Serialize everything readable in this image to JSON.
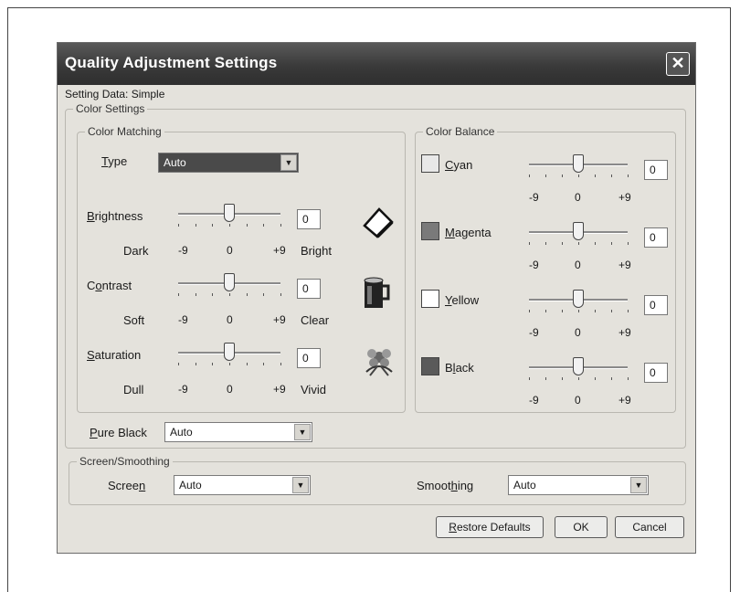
{
  "dialog": {
    "title": "Quality Adjustment Settings",
    "close_label": "✕",
    "setting_data": "Setting Data: Simple"
  },
  "color_settings": {
    "legend": "Color Settings",
    "color_matching": {
      "legend": "Color Matching",
      "type_label": "Type",
      "type_value": "Auto",
      "sliders": [
        {
          "label": "Brightness",
          "value": "0",
          "low_label": "Dark",
          "high_label": "Bright",
          "min": "-9",
          "mid": "0",
          "max": "+9",
          "level": 0,
          "icon": "page-icon"
        },
        {
          "label": "Contrast",
          "value": "0",
          "low_label": "Soft",
          "high_label": "Clear",
          "min": "-9",
          "mid": "0",
          "max": "+9",
          "level": 0,
          "icon": "mug-icon"
        },
        {
          "label": "Saturation",
          "value": "0",
          "low_label": "Dull",
          "high_label": "Vivid",
          "min": "-9",
          "mid": "0",
          "max": "+9",
          "level": 0,
          "icon": "flower-icon"
        }
      ]
    },
    "color_balance": {
      "legend": "Color Balance",
      "channels": [
        {
          "label": "Cyan",
          "value": "0",
          "min": "-9",
          "mid": "0",
          "max": "+9",
          "swatch": "#e8e8e8"
        },
        {
          "label": "Magenta",
          "value": "0",
          "min": "-9",
          "mid": "0",
          "max": "+9",
          "swatch": "#7a7a7a"
        },
        {
          "label": "Yellow",
          "value": "0",
          "min": "-9",
          "mid": "0",
          "max": "+9",
          "swatch": "#ffffff"
        },
        {
          "label": "Black",
          "value": "0",
          "min": "-9",
          "mid": "0",
          "max": "+9",
          "swatch": "#5a5a5a"
        }
      ]
    },
    "pure_black_label": "Pure Black",
    "pure_black_value": "Auto"
  },
  "screen_smoothing": {
    "legend": "Screen/Smoothing",
    "screen_label": "Screen",
    "screen_value": "Auto",
    "smoothing_label": "Smoothing",
    "smoothing_value": "Auto"
  },
  "buttons": {
    "restore": "Restore Defaults",
    "ok": "OK",
    "cancel": "Cancel"
  }
}
